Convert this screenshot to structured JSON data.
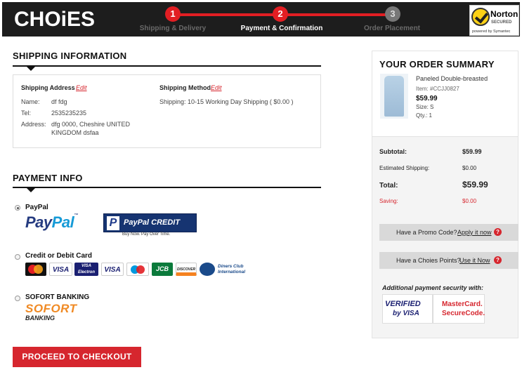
{
  "header": {
    "logo": "CHOiES",
    "steps": [
      {
        "number": "1",
        "label": "Shipping & Delivery",
        "state": "done"
      },
      {
        "number": "2",
        "label": "Payment & Confirmation",
        "state": "active"
      },
      {
        "number": "3",
        "label": "Order Placement",
        "state": "pending"
      }
    ],
    "norton": {
      "title": "Norton",
      "secured": "SECURED",
      "powered": "powered by Symantec"
    }
  },
  "shipping": {
    "title": "SHIPPING INFORMATION",
    "address_label": "Shipping Address",
    "method_label": "Shipping Method",
    "edit_label": "Edit",
    "name_key": "Name:",
    "name_value": "df fdg",
    "tel_key": "Tel:",
    "tel_value": "2535235235",
    "address_key": "Address:",
    "address_line1": "dfg 0000, Cheshire UNITED",
    "address_line2": "KINGDOM dsfaa",
    "method_value": "Shipping: 10-15 Working Day Shipping ( $0.00 )"
  },
  "payment": {
    "title": "PAYMENT INFO",
    "paypal_label": "PayPal",
    "paypal_logo_a": "Pay",
    "paypal_logo_b": "Pal",
    "paypal_tm": "™",
    "paypal_credit_p": "P",
    "paypal_credit": "PayPal CREDIT",
    "paypal_credit_sub": "Buy Now. Pay Over Time.",
    "card_label": "Credit or Debit Card",
    "cards": [
      "MasterCard",
      "VISA",
      "VISA Electron",
      "VISA",
      "Maestro",
      "JCB",
      "DISCOVER",
      "Diners Club International"
    ],
    "sofort_label": "SOFORT BANKING",
    "sofort_logo": "SOFORT",
    "sofort_sub": "BANKING",
    "checkout_button": "PROCEED TO CHECKOUT"
  },
  "summary": {
    "title": "YOUR ORDER SUMMARY",
    "product_name": "Paneled Double-breasted",
    "item": "Item: #CCJJ0827",
    "price": "$59.99",
    "size": "Size: S",
    "qty": "Qty.: 1",
    "subtotal_key": "Subtotal:",
    "subtotal_value": "$59.99",
    "est_shipping_key": "Estimated Shipping:",
    "est_shipping_value": "$0.00",
    "total_key": "Total:",
    "total_value": "$59.99",
    "saving_key": "Saving:",
    "saving_value": "$0.00",
    "promo_text": "Have a Promo Code?",
    "promo_link": "Apply it now",
    "points_text": "Have a Choies Points?",
    "points_link": "Use it Now",
    "question_mark": "?",
    "security_title": "Additional payment security with:",
    "vbv_line1": "VERIFIED",
    "vbv_line2": "by VISA",
    "msc_line1": "MasterCard.",
    "msc_line2": "SecureCode."
  },
  "colors": {
    "accent": "#d6262e",
    "header_bg": "#1d1d1d",
    "paypal_dark": "#253b80",
    "paypal_light": "#179bd7",
    "sofort": "#f08a24"
  }
}
